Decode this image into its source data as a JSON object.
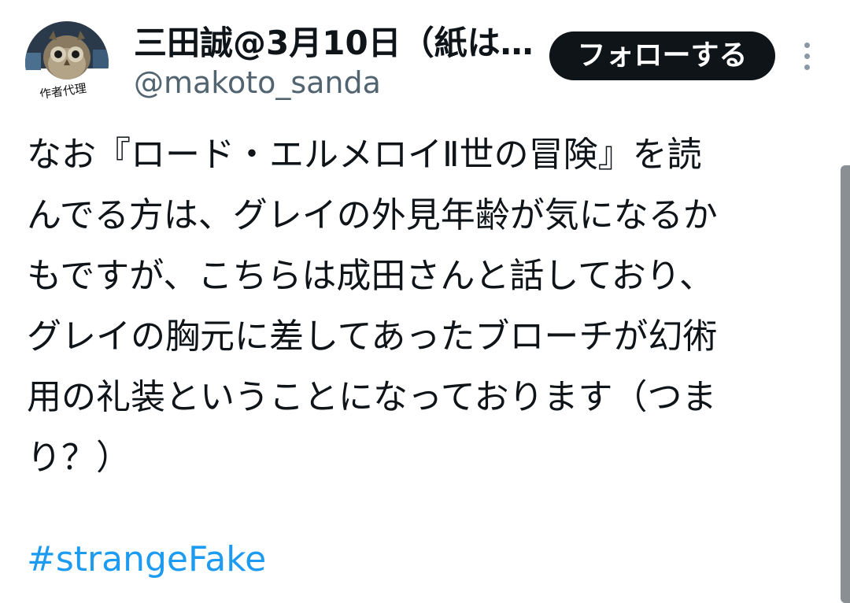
{
  "author": {
    "display_name": "三田誠@3月10日（紙は…",
    "handle": "@makoto_sanda",
    "avatar": {
      "icon": "owl-avatar",
      "caption": "作者代理"
    }
  },
  "actions": {
    "follow_label": "フォローする",
    "more_icon": "more-vertical-icon"
  },
  "tweet": {
    "lines": [
      "なお『ロード・エルメロイⅡ世の冒険』を読",
      "んでる方は、グレイの外見年齢が気になるか",
      "もですが、こちらは成田さんと話しており、",
      "グレイの胸元に差してあったブローチが幻術",
      "用の礼装ということになっております（つま",
      "り？）"
    ],
    "hashtag": "#strangeFake"
  },
  "colors": {
    "text": "#0f1419",
    "secondary_text": "#536471",
    "link": "#1d9bf0",
    "button_bg": "#0f1419",
    "button_text": "#ffffff"
  }
}
